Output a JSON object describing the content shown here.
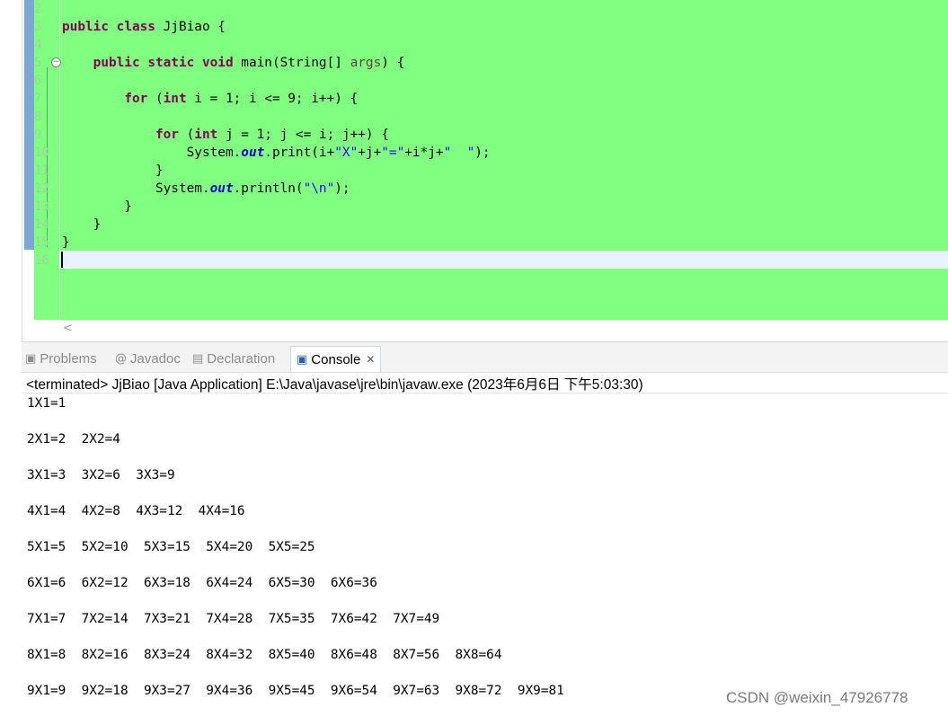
{
  "editor": {
    "line_numbers": [
      "2",
      "3",
      "4",
      "5",
      "6",
      "7",
      "8",
      "9",
      "10",
      "11",
      "12",
      "13",
      "14",
      "15",
      "16"
    ],
    "code": {
      "l3": {
        "kw1": "public",
        "kw2": "class",
        "rest": " JjBiao {"
      },
      "l5": {
        "indent": "    ",
        "kw1": "public",
        "kw2": "static",
        "kw3": "void",
        "mid": " main(String[] ",
        "arg": "args",
        "rest": ") {"
      },
      "l7": {
        "indent": "        ",
        "kw1": "for",
        "a": " (",
        "kw2": "int",
        "rest": " i = 1; i <= 9; i++) {"
      },
      "l9": {
        "indent": "            ",
        "kw1": "for",
        "a": " (",
        "kw2": "int",
        "rest": " j = 1; j <= i; j++) {"
      },
      "l10": {
        "p1": "                System.",
        "fld": "out",
        "p2": ".print(i+",
        "s1": "\"X\"",
        "p3": "+j+",
        "s2": "\"=\"",
        "p4": "+i*j+",
        "s3": "\"  \"",
        "p5": ");"
      },
      "l11": "            }",
      "l12": {
        "p1": "            System.",
        "fld": "out",
        "p2": ".println(",
        "s1": "\"\\n\"",
        "p3": ");"
      },
      "l13": "        }",
      "l14": "    }",
      "l15": "}"
    },
    "fold_icon": "minus-icon"
  },
  "views": {
    "tabs": [
      {
        "label": "Problems",
        "icon": "problems-icon"
      },
      {
        "label": "Javadoc",
        "icon": "javadoc-icon"
      },
      {
        "label": "Declaration",
        "icon": "declaration-icon"
      },
      {
        "label": "Console",
        "icon": "console-icon",
        "active": true
      }
    ],
    "close_glyph": "✕"
  },
  "console": {
    "terminated": "<terminated> JjBiao [Java Application] E:\\Java\\javase\\jre\\bin\\javaw.exe (2023年6月6日 下午5:03:30)",
    "output": [
      "1X1=1",
      "2X1=2  2X2=4",
      "3X1=3  3X2=6  3X3=9",
      "4X1=4  4X2=8  4X3=12  4X4=16",
      "5X1=5  5X2=10  5X3=15  5X4=20  5X5=25",
      "6X1=6  6X2=12  6X3=18  6X4=24  6X5=30  6X6=36",
      "7X1=7  7X2=14  7X3=21  7X4=28  7X5=35  7X6=42  7X7=49",
      "8X1=8  8X2=16  8X3=24  8X4=32  8X5=40  8X6=48  8X7=56  8X8=64",
      "9X1=9  9X2=18  9X3=27  9X4=36  9X5=45  9X6=54  9X7=63  9X8=72  9X9=81"
    ]
  },
  "watermark": "CSDN @weixin_47926778",
  "colors": {
    "editor_bg": "#80ff80",
    "keyword": "#7f0055",
    "string": "#2a00ff",
    "field": "#0000c0"
  }
}
